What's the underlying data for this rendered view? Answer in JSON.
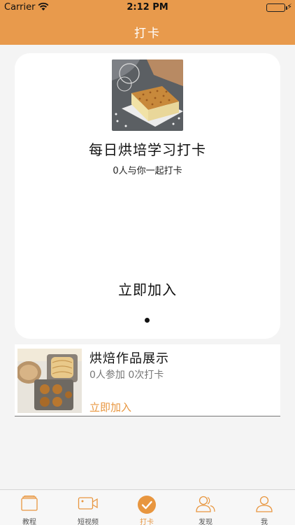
{
  "status_bar": {
    "carrier": "Carrier",
    "time": "2:12 PM"
  },
  "nav": {
    "title": "打卡"
  },
  "colors": {
    "accent": "#e89a4c",
    "accent_text": "#e8963f"
  },
  "featured": {
    "title": "每日烘培学习打卡",
    "subtitle": "0人与你一起打卡",
    "join_label": "立即加入",
    "image_icon": "cake-photo"
  },
  "list": [
    {
      "title": "烘焙作品展示",
      "stats": "0人参加  0次打卡",
      "join_label": "立即加入",
      "image_icon": "bread-photo"
    }
  ],
  "tabs": [
    {
      "label": "教程",
      "icon": "folder-icon",
      "active": false
    },
    {
      "label": "短视频",
      "icon": "video-camera-icon",
      "active": false
    },
    {
      "label": "打卡",
      "icon": "checkmark-icon",
      "active": true
    },
    {
      "label": "发现",
      "icon": "people-icon",
      "active": false
    },
    {
      "label": "我",
      "icon": "person-icon",
      "active": false
    }
  ]
}
